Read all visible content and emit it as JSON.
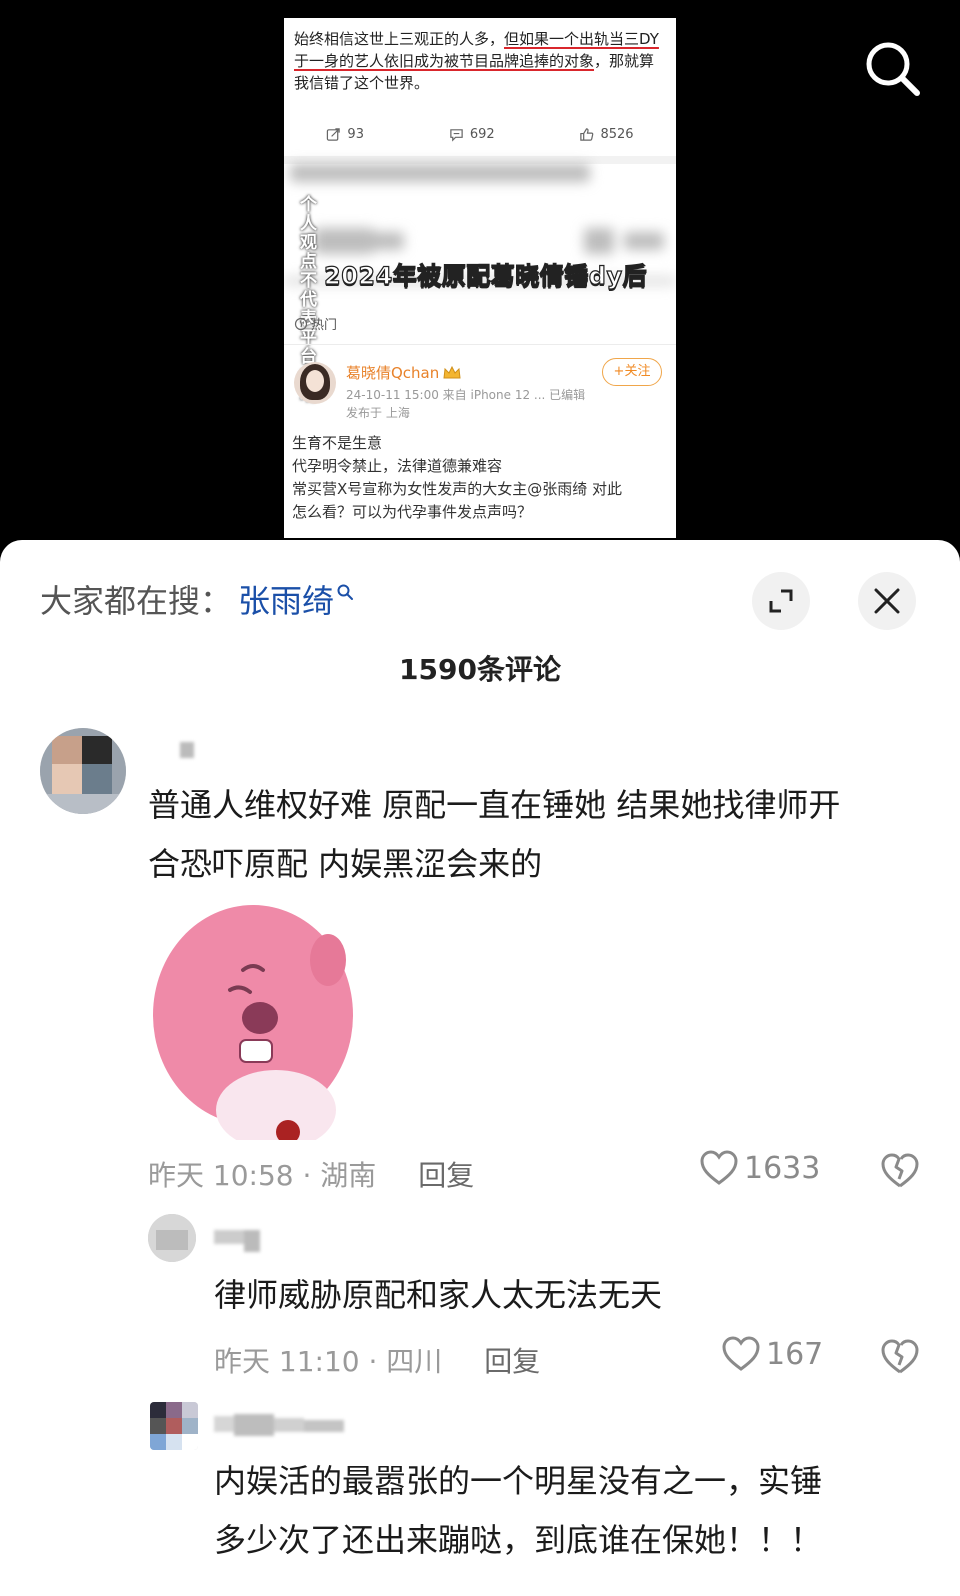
{
  "video": {
    "post_text_1": "始终相信这世上三观正的人多，",
    "post_text_ul1": "但如果一个出轨当三",
    "post_text_ul2": "DY于一身的艺人依旧成为被节目品牌追捧的对象",
    "post_text_2": "，那就算我信错了这个世界。",
    "stats": {
      "reposts": "93",
      "comments": "692",
      "likes": "8526"
    },
    "side_caption": "个人观点不代表平台立场",
    "overlay_title": "2024年被原配葛晓倩锤dy后",
    "hot_label": "热门",
    "author": {
      "name": "葛晓倩Qchan",
      "meta_line1": "24-10-11 15:00  来自 iPhone 12 ...  已编辑",
      "meta_line2": "发布于 上海"
    },
    "follow_label": "+关注",
    "body_lines": [
      "生育不是生意",
      "代孕明令禁止，法律道德兼难容",
      "常买营X号宣称为女性发声的大女主@张雨绮 对此",
      "怎么看？可以为代孕事件发点声吗？"
    ]
  },
  "sheet": {
    "search_prefix": "大家都在搜：",
    "search_term": "张雨绮",
    "comment_count_title": "1590条评论",
    "reply_label": "回复"
  },
  "comments": [
    {
      "text_line1": "普通人维权好难 原配一直在锤她 结果她找律师开",
      "text_line2": "合恐吓原配 内娱黑涩会来的",
      "time": "昨天 10:58 · 湖南",
      "likes": "1633"
    },
    {
      "text_line1": "律师威胁原配和家人太无法无天",
      "time": "昨天 11:10 · 四川",
      "likes": "167"
    },
    {
      "text_line1": "内娱活的最嚣张的一个明星没有之一，实锤",
      "text_line2": "多少次了还出来蹦哒，到底谁在保她！！！"
    }
  ],
  "icons": {
    "top_search": "search-icon",
    "expand": "expand-icon",
    "close": "close-icon",
    "like": "heart-icon",
    "dislike": "broken-heart-icon"
  },
  "colors": {
    "accent_blue": "#1a4fa8",
    "underline_red": "#d9262c",
    "follow_orange": "#f08a24"
  }
}
